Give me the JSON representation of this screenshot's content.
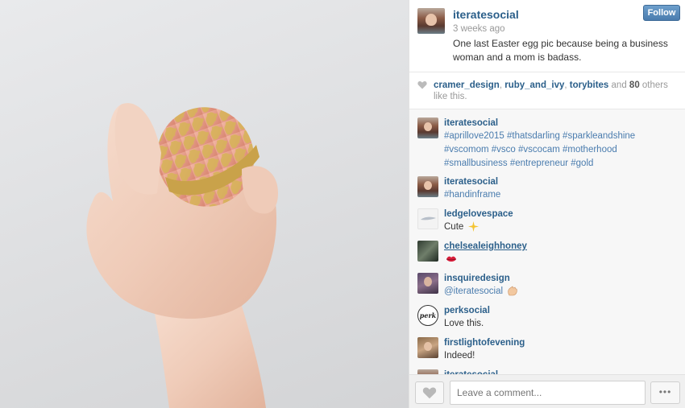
{
  "post": {
    "username": "iteratesocial",
    "time_ago": "3 weeks ago",
    "caption": "One last Easter egg pic because being a business woman and a mom is badass.",
    "follow_label": "Follow"
  },
  "likes": {
    "users": [
      "cramer_design",
      "ruby_and_ivy",
      "torybites"
    ],
    "sep1": ", ",
    "sep2": ", ",
    "and_text": " and ",
    "count": "80",
    "tail": " others like this."
  },
  "comments": [
    {
      "user": "iteratesocial",
      "text": "#aprillove2015 #thatsdarling #sparkleandshine #vscomom #vsco #vscocam #motherhood #smallbusiness #entrepreneur #gold",
      "avatar": "iteratesocial-avatar"
    },
    {
      "user": "iteratesocial",
      "text": "#handinframe",
      "avatar": "iteratesocial-avatar"
    },
    {
      "user": "ledgelovespace",
      "text": "Cute",
      "emoji": "sparkle-emoji",
      "avatar": "feather-avatar"
    },
    {
      "user": "chelsealeighhoney",
      "text": "",
      "emoji": "kiss-lips-emoji",
      "avatar": "plant-avatar"
    },
    {
      "user": "insquiredesign",
      "text": "@iteratesocial",
      "emoji": "clapping-hands-emoji",
      "avatar": "woman-avatar"
    },
    {
      "user": "perksocial",
      "text": "Love this.",
      "avatar": "perk-logo-avatar",
      "logo_text": "perk"
    },
    {
      "user": "firstlightofevening",
      "text": "Indeed!",
      "avatar": "woman-avatar-2"
    },
    {
      "user": "iteratesocial",
      "text": "",
      "avatar": "iteratesocial-avatar"
    }
  ],
  "footer": {
    "comment_placeholder": "Leave a comment...",
    "more_label": "•••"
  },
  "colors": {
    "link_blue": "#2b5f8a",
    "hashtag_blue": "#4a7cae",
    "follow_button": "#4a7cae",
    "gold_foil": "#c9a24a",
    "rose_gold": "#e9a08e"
  }
}
